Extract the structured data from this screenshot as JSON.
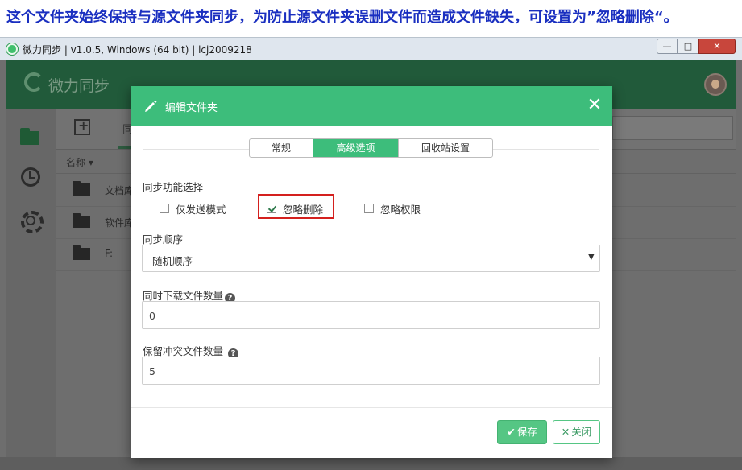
{
  "caption": "这个文件夹始终保持与源文件夹同步，为防止源文件夹误删文件而造成文件缺失，可设置为”忽略删除“。",
  "window": {
    "title": "微力同步 | v1.0.5, Windows (64 bit) | lcj2009218",
    "min_label": "—",
    "max_label": "□",
    "close_label": "✕"
  },
  "app": {
    "name": "微力同步",
    "toolbar_text": "同",
    "column_name": "名称 ▾",
    "rows": [
      {
        "name": "文档库"
      },
      {
        "name": "软件库"
      },
      {
        "name": "F:"
      }
    ]
  },
  "dialog": {
    "title": "编辑文件夹",
    "close_label": "✕",
    "tabs": [
      {
        "label": "常规"
      },
      {
        "label": "高级选项"
      },
      {
        "label": "回收站设置"
      }
    ],
    "active_tab": "高级选项",
    "sync_function_label": "同步功能选择",
    "checkboxes": [
      {
        "label": "仅发送模式",
        "checked": false
      },
      {
        "label": "忽略删除",
        "checked": true
      },
      {
        "label": "忽略权限",
        "checked": false
      }
    ],
    "sync_order_label": "同步顺序",
    "sync_order_value": "随机顺序",
    "download_count_label": "同时下载文件数量",
    "download_count_value": "0",
    "conflict_count_label": "保留冲突文件数量",
    "conflict_count_value": "5",
    "help_glyph": "?",
    "save_icon": "✔",
    "save_label": "保存",
    "close_icon": "✕",
    "close_button_label": "关闭"
  },
  "colors": {
    "accent": "#3dbd7b",
    "caption_text": "#1a2fc0",
    "highlight_box": "#d4201e"
  }
}
